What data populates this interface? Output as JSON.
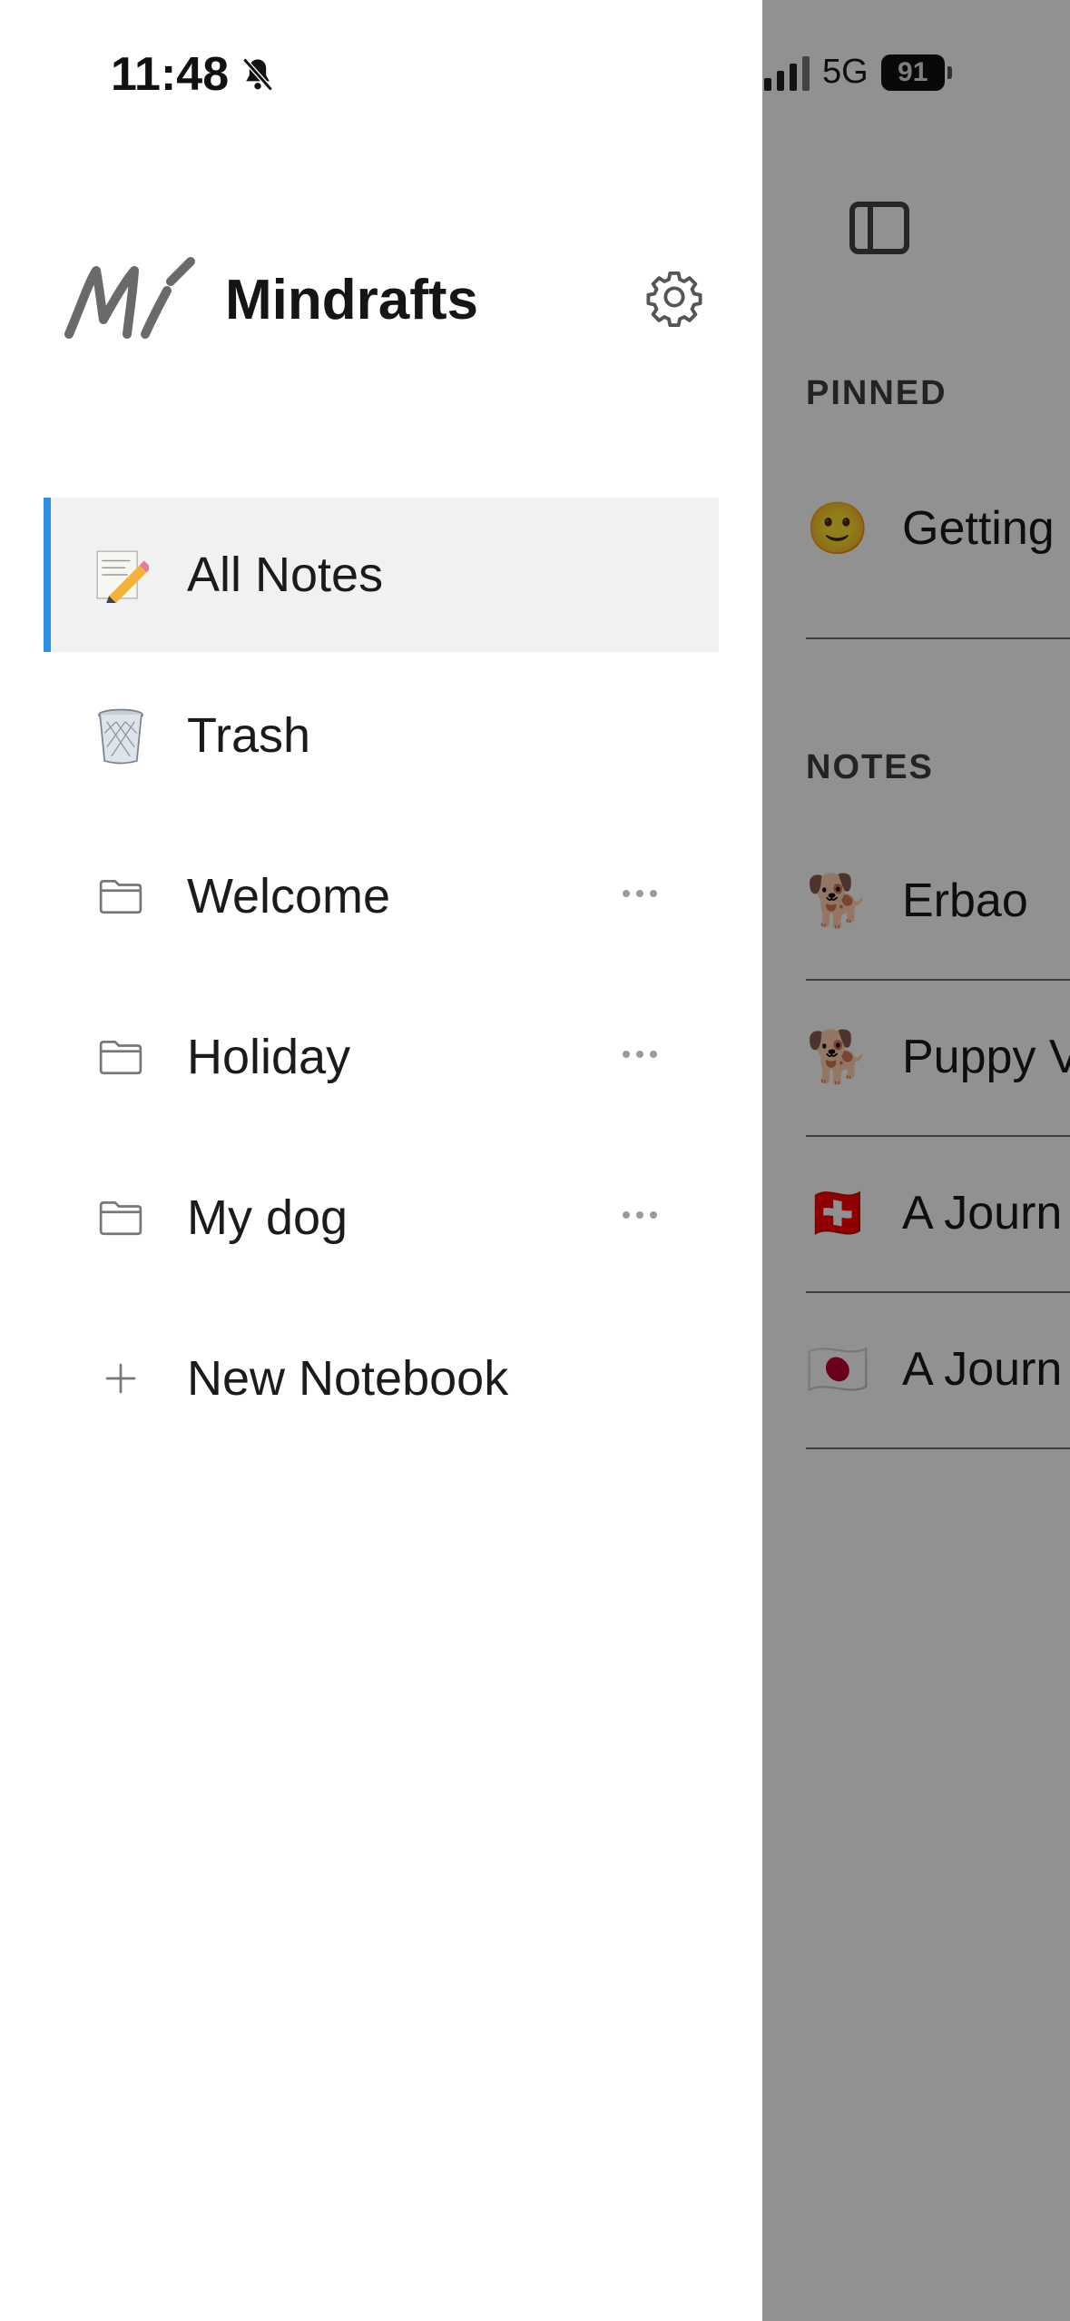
{
  "status": {
    "time": "11:48",
    "network": "5G",
    "battery": "91"
  },
  "brand": {
    "name": "Mindrafts"
  },
  "nav": {
    "items": [
      {
        "label": "All Notes",
        "icon": "memo-icon",
        "active": true
      },
      {
        "label": "Trash",
        "icon": "wastebasket-icon"
      },
      {
        "label": "Welcome",
        "icon": "folder-icon",
        "has_menu": true
      },
      {
        "label": "Holiday",
        "icon": "folder-icon",
        "has_menu": true
      },
      {
        "label": "My dog",
        "icon": "folder-icon",
        "has_menu": true
      },
      {
        "label": "New Notebook",
        "icon": "plus-icon"
      }
    ]
  },
  "main": {
    "pinned_label": "PINNED",
    "notes_label": "NOTES",
    "pinned": [
      {
        "emoji": "🙂",
        "title": "Getting"
      }
    ],
    "notes": [
      {
        "emoji": "🐕",
        "title": "Erbao"
      },
      {
        "emoji": "🐕",
        "title": "Puppy V"
      },
      {
        "emoji": "🇨🇭",
        "title": "A Journ"
      },
      {
        "emoji": "🇯🇵",
        "title": "A Journ"
      }
    ]
  },
  "colors": {
    "accent": "#2e8fe6",
    "overlay": "rgba(0,0,0,0.43)"
  }
}
